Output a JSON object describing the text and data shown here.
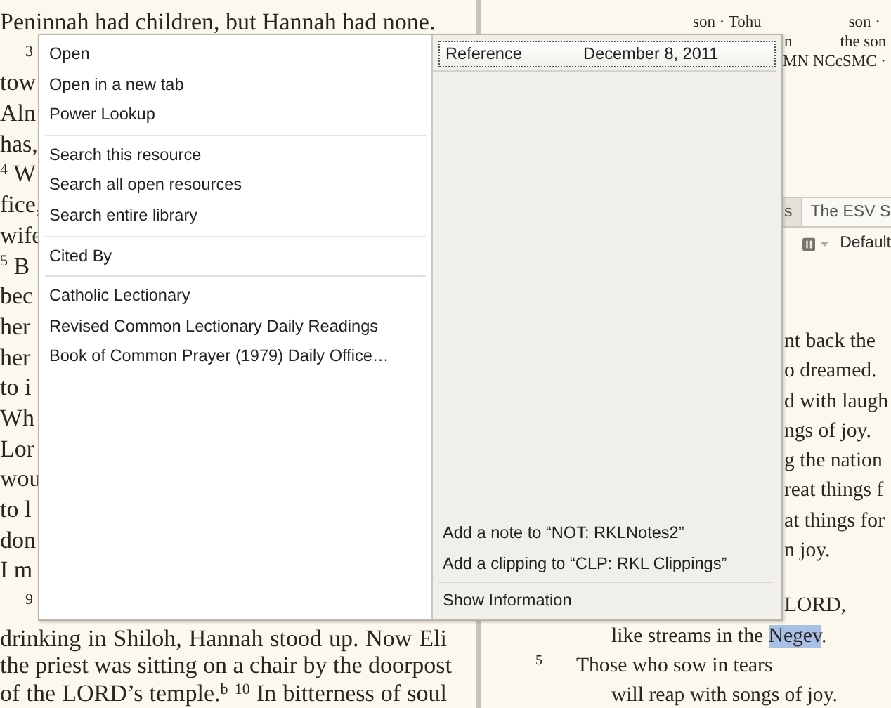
{
  "left_pane": {
    "lines": [
      {
        "kind": "full",
        "text": "Peninnah had children, but Hannah had none."
      },
      {
        "kind": "verse",
        "text": "3"
      },
      {
        "kind": "cut",
        "text": "tow"
      },
      {
        "kind": "cut",
        "text": "Aln"
      },
      {
        "kind": "cut",
        "text": "has,"
      },
      {
        "kind": "cut",
        "text": "$^{4}$ W"
      },
      {
        "kind": "cut",
        "text": "fice,"
      },
      {
        "kind": "cut",
        "text": "wife"
      },
      {
        "kind": "cut",
        "text": "$^{5}$ B"
      },
      {
        "kind": "cut",
        "text": "bec"
      },
      {
        "kind": "cut",
        "text": "her"
      },
      {
        "kind": "cut",
        "text": "her"
      },
      {
        "kind": "cut",
        "text": "to i"
      },
      {
        "kind": "cut",
        "text": "Wh"
      },
      {
        "kind": "cut",
        "text": "Lor"
      },
      {
        "kind": "cut",
        "text": "wou"
      },
      {
        "kind": "cut",
        "text": "to l"
      },
      {
        "kind": "cut",
        "text": "don"
      },
      {
        "kind": "cut",
        "text": "I m"
      },
      {
        "kind": "verse",
        "text": "9"
      },
      {
        "kind": "justified",
        "text": "drinking in Shiloh, Hannah stood up. Now Eli"
      },
      {
        "kind": "justified",
        "text": "the priest was sitting on a chair by the doorpost"
      },
      {
        "kind": "justified",
        "text": "of the LORD’s temple.$^{b}$ $^{10}$ In bitterness of soul"
      }
    ]
  },
  "right_pane": {
    "interlinear": [
      {
        "kind": "row1",
        "words": [
          "son · Tohu",
          "son ·"
        ]
      },
      {
        "kind": "row2",
        "words": [
          "n",
          "the son"
        ]
      },
      {
        "kind": "row3",
        "words": [
          "MN NCcSMC ·"
        ]
      }
    ],
    "tabs": [
      {
        "label": "s",
        "selected": false
      },
      {
        "label": "The ESV S",
        "selected": true
      }
    ],
    "toolbar": {
      "layout": "Default"
    },
    "lines": [
      {
        "kind": "cut",
        "parts": [
          {
            "text": "nt back the",
            "selected": false
          }
        ]
      },
      {
        "kind": "cut",
        "parts": [
          {
            "text": "o dreamed.",
            "selected": false
          }
        ]
      },
      {
        "kind": "cut",
        "parts": [
          {
            "text": "d with laugh",
            "selected": false
          }
        ]
      },
      {
        "kind": "cut",
        "parts": [
          {
            "text": "ngs of joy.",
            "selected": false
          }
        ]
      },
      {
        "kind": "cut",
        "parts": [
          {
            "text": "g the nation",
            "selected": false
          }
        ]
      },
      {
        "kind": "cut",
        "parts": [
          {
            "text": "reat things f",
            "selected": false
          }
        ]
      },
      {
        "kind": "cut",
        "parts": [
          {
            "text": "at things for",
            "selected": false
          }
        ]
      },
      {
        "kind": "cut",
        "parts": [
          {
            "text": "n joy.",
            "selected": false
          }
        ]
      },
      {
        "kind": "gap"
      },
      {
        "kind": "cut",
        "parts": [
          {
            "text": "LORD,",
            "selected": false
          }
        ]
      },
      {
        "kind": "indent",
        "parts": [
          {
            "text": "like streams in the ",
            "selected": false
          },
          {
            "text": "Negev",
            "selected": true
          },
          {
            "text": ".",
            "selected": false
          }
        ]
      },
      {
        "kind": "verse",
        "verse": "5",
        "parts": [
          {
            "text": "Those who sow in tears",
            "selected": false
          }
        ]
      },
      {
        "kind": "indent",
        "parts": [
          {
            "text": "will reap with songs of joy.",
            "selected": false
          }
        ]
      }
    ]
  },
  "context_menu": {
    "items": [
      {
        "kind": "item",
        "label": "Open"
      },
      {
        "kind": "item",
        "label": "Open in a new tab"
      },
      {
        "kind": "item",
        "label": "Power Lookup"
      },
      {
        "kind": "separator"
      },
      {
        "kind": "item",
        "label": "Search this resource"
      },
      {
        "kind": "item",
        "label": "Search all open resources"
      },
      {
        "kind": "item",
        "label": "Search entire library"
      },
      {
        "kind": "separator"
      },
      {
        "kind": "item",
        "label": "Cited By"
      },
      {
        "kind": "separator"
      },
      {
        "kind": "item",
        "label": "Catholic Lectionary"
      },
      {
        "kind": "item",
        "label": "Revised Common Lectionary Daily Readings"
      },
      {
        "kind": "item",
        "label": "Book of Common Prayer (1979) Daily Office…"
      }
    ],
    "panel": {
      "header": {
        "label": "Reference",
        "value": "December 8, 2011"
      },
      "actions": [
        {
          "kind": "item",
          "label": "Add a note to “NOT: RKLNotes2”"
        },
        {
          "kind": "item",
          "label": "Add a clipping to “CLP: RKL Clippings”"
        },
        {
          "kind": "separator"
        },
        {
          "kind": "item",
          "label": "Show Information"
        }
      ]
    }
  }
}
